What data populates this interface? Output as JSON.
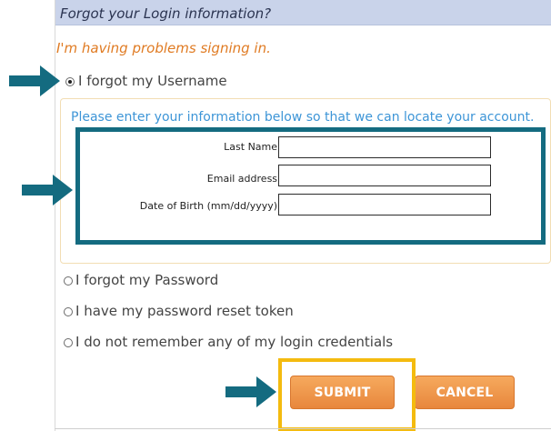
{
  "header": {
    "title": "Forgot your Login information?"
  },
  "subtitle": "I'm having problems signing in.",
  "options": {
    "username": {
      "label": "I forgot my Username",
      "selected": true
    },
    "password": {
      "label": "I forgot my Password",
      "selected": false
    },
    "token": {
      "label": "I have my password reset token",
      "selected": false
    },
    "all": {
      "label": "I do not remember any of my login credentials",
      "selected": false
    }
  },
  "info": {
    "text": "Please enter your information below so that we can locate your account."
  },
  "form": {
    "last_name": {
      "label": "Last Name:",
      "required": "*",
      "value": ""
    },
    "email": {
      "label": "Email address:",
      "required": "*",
      "value": ""
    },
    "dob": {
      "label": "Date of Birth (mm/dd/yyyy):",
      "required": "*",
      "value": ""
    }
  },
  "buttons": {
    "submit": "SUBMIT",
    "cancel": "CANCEL"
  },
  "colors": {
    "header_bg": "#c9d3ea",
    "accent_orange": "#e07b23",
    "info_blue": "#3d95d7",
    "annotation_teal": "#146b80",
    "highlight_yellow": "#f4bb0f",
    "required_red": "#d72222"
  },
  "annotations": [
    {
      "name": "arrow-icon",
      "points_to": "username-option"
    },
    {
      "name": "arrow-icon",
      "points_to": "form-fields"
    },
    {
      "name": "arrow-icon",
      "points_to": "submit-button"
    }
  ]
}
